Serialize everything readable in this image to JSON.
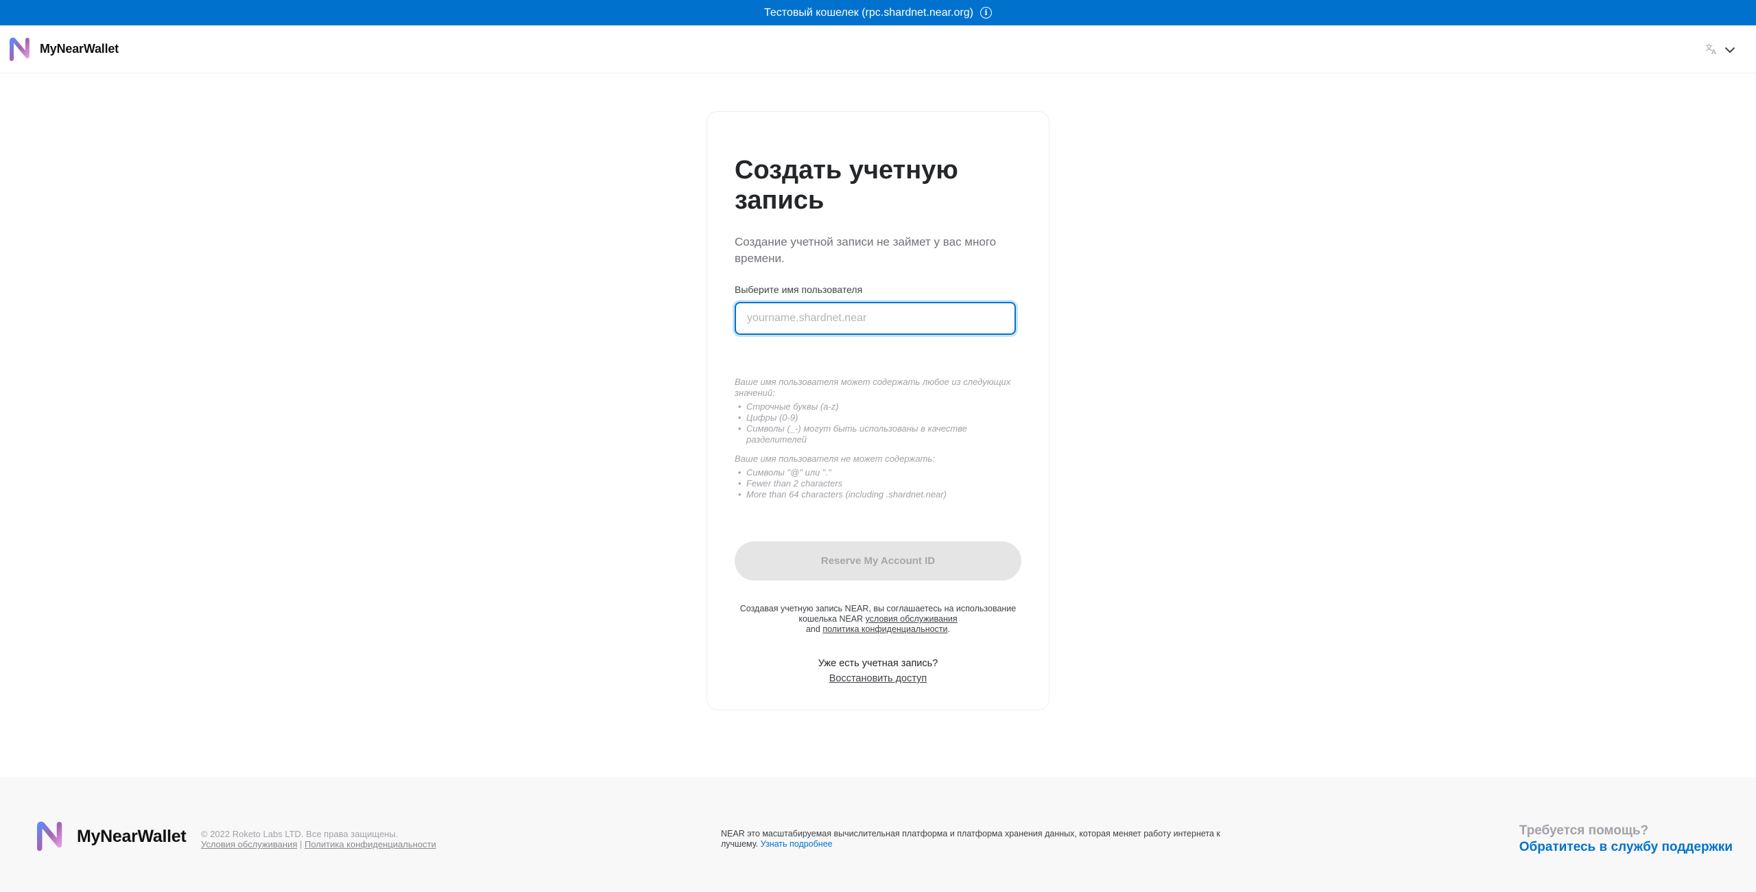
{
  "banner": {
    "text": "Тестовый кошелек (rpc.shardnet.near.org)"
  },
  "header": {
    "logo_text": "MyNearWallet"
  },
  "card": {
    "title": "Создать учетную запись",
    "subtitle": "Создание учетной записи не займет у вас много времени.",
    "field_label": "Выберите имя пользователя",
    "input_placeholder": "yourname.shardnet.near",
    "input_value": "",
    "can_intro": "Ваше имя пользователя может содержать любое из следующих значений:",
    "can_items": [
      "Строчные буквы (a-z)",
      "Цифры (0-9)",
      "Символы (_-) могут быть использованы в качестве разделителей"
    ],
    "cannot_intro": "Ваше имя пользователя не может содержать:",
    "cannot_items": [
      "Символы \"@\" или \".\"",
      "Fewer than 2 characters",
      "More than 64 characters (including .shardnet.near)"
    ],
    "reserve_button": "Reserve My Account ID",
    "terms_prefix": "Создавая учетную запись NEAR, вы соглашаетесь на использование кошелька NEAR",
    "terms_link": "условия обслуживания",
    "terms_and": "and",
    "privacy_link": "политика конфиденциальности",
    "terms_suffix": ".",
    "have_account": "Уже есть учетная запись?",
    "recover_link": "Восстановить доступ"
  },
  "footer": {
    "logo_text": "MyNearWallet",
    "copyright": "© 2022 Roketo Labs LTD. Все права защищены.",
    "terms_link": "Условия обслуживания",
    "separator": "|",
    "privacy_link": "Политика конфиденциальности",
    "about_text": "NEAR это масштабируемая вычислительная платформа и платформа хранения данных, которая меняет работу интернета к лучшему.",
    "about_link": "Узнать подробнее",
    "help_question": "Требуется помощь?",
    "help_link": "Обратитесь в службу поддержки"
  },
  "colors": {
    "accent": "#0072ce",
    "banner_bg": "#0072ce",
    "disabled_button": "#e5e5e6",
    "footer_bg": "#f8f8f8"
  },
  "icons": {
    "banner": "info-icon",
    "language": "translate-icon",
    "language_caret": "chevron-down-icon",
    "logo": "near-logo-icon"
  }
}
